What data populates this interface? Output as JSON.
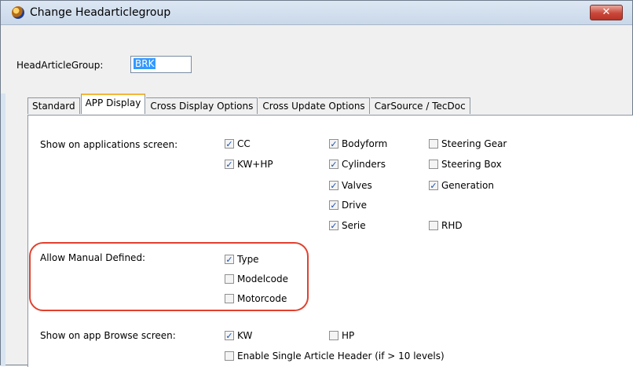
{
  "window": {
    "title": "Change Headarticlegroup",
    "close_label": "✕"
  },
  "head_article_group": {
    "label": "HeadArticleGroup:",
    "value": "BRK"
  },
  "tabs": [
    {
      "label": "Standard"
    },
    {
      "label": "APP Display"
    },
    {
      "label": "Cross Display Options"
    },
    {
      "label": "Cross Update Options"
    },
    {
      "label": "CarSource / TecDoc"
    }
  ],
  "active_tab": "APP Display",
  "applications": {
    "label": "Show on applications screen:",
    "options": [
      {
        "label": "CC",
        "checked": true
      },
      {
        "label": "KW+HP",
        "checked": true
      },
      {
        "label": "Bodyform",
        "checked": true
      },
      {
        "label": "Cylinders",
        "checked": true
      },
      {
        "label": "Valves",
        "checked": true
      },
      {
        "label": "Drive",
        "checked": true
      },
      {
        "label": "Serie",
        "checked": true
      },
      {
        "label": "Steering Gear",
        "checked": false
      },
      {
        "label": "Steering Box",
        "checked": false
      },
      {
        "label": "Generation",
        "checked": true
      },
      {
        "label": "RHD",
        "checked": false
      }
    ]
  },
  "manual": {
    "label": "Allow Manual Defined:",
    "options": [
      {
        "label": "Type",
        "checked": true
      },
      {
        "label": "Modelcode",
        "checked": false
      },
      {
        "label": "Motorcode",
        "checked": false
      }
    ]
  },
  "browse": {
    "label": "Show on app Browse screen:",
    "options": [
      {
        "label": "KW",
        "checked": true
      },
      {
        "label": "HP",
        "checked": false
      },
      {
        "label": "Enable Single Article Header (if > 10 levels)",
        "checked": false
      }
    ]
  },
  "colors": {
    "highlight": "#e2402e",
    "title_bar": "#d3e0ef",
    "accent": "#3399ff"
  }
}
